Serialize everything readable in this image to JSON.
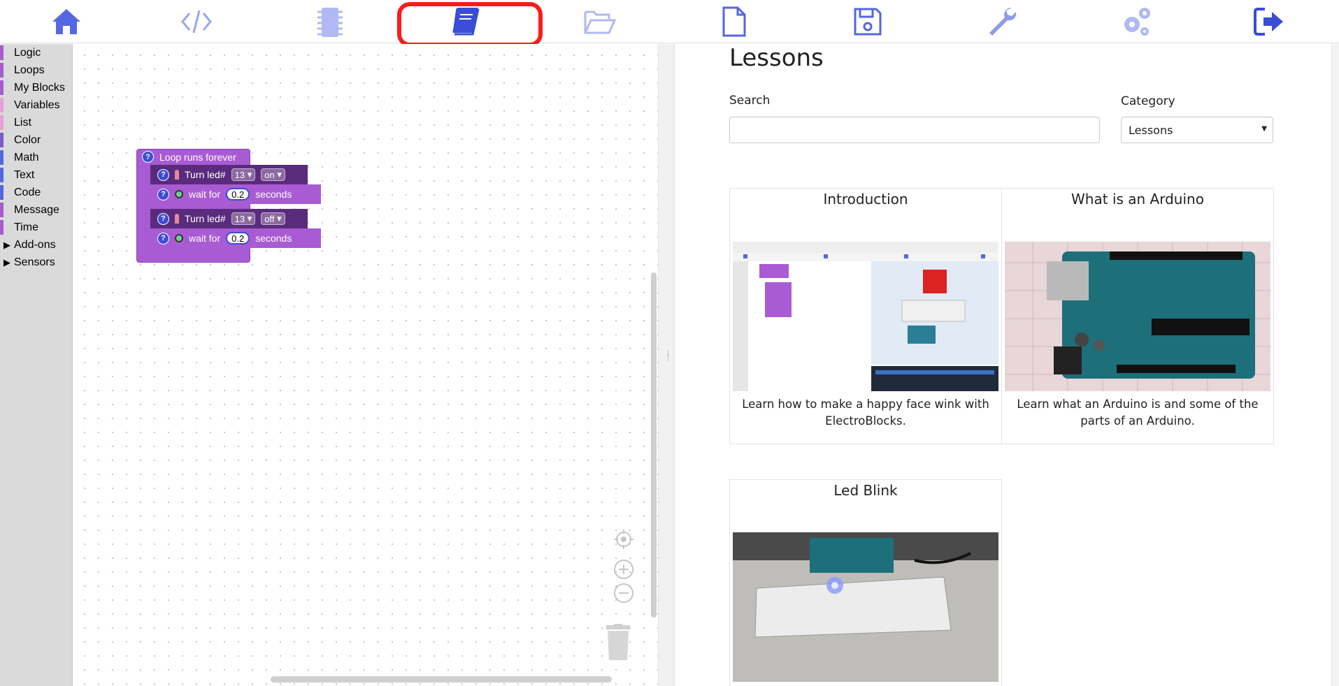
{
  "nav": {
    "items": [
      {
        "name": "home",
        "icon": "home-icon"
      },
      {
        "name": "code",
        "icon": "code-icon"
      },
      {
        "name": "chip",
        "icon": "chip-icon"
      },
      {
        "name": "lessons",
        "icon": "book-icon",
        "active": true
      },
      {
        "name": "open",
        "icon": "folder-open-icon"
      },
      {
        "name": "new",
        "icon": "new-file-icon"
      },
      {
        "name": "save",
        "icon": "save-icon"
      },
      {
        "name": "tools",
        "icon": "wrench-icon"
      },
      {
        "name": "settings",
        "icon": "gears-icon"
      },
      {
        "name": "exit",
        "icon": "sign-out-icon"
      }
    ],
    "icon_color": "#5567e0",
    "active_ring_color": "#ff1a1a"
  },
  "toolbox": {
    "categories": [
      {
        "label": "Logic",
        "color": "#a55ccf"
      },
      {
        "label": "Loops",
        "color": "#a55ccf"
      },
      {
        "label": "My Blocks",
        "color": "#a55ccf"
      },
      {
        "label": "Variables",
        "color": "#e8a0d8"
      },
      {
        "label": "List",
        "color": "#e8a0d8"
      },
      {
        "label": "Color",
        "color": "#7a5ccf"
      },
      {
        "label": "Math",
        "color": "#5567e0"
      },
      {
        "label": "Text",
        "color": "#5567e0"
      },
      {
        "label": "Code",
        "color": "#5567e0"
      },
      {
        "label": "Message",
        "color": "#a55ccf"
      },
      {
        "label": "Time",
        "color": "#a55ccf"
      },
      {
        "label": "Add-ons",
        "color": "#dadada",
        "expandable": true
      },
      {
        "label": "Sensors",
        "color": "#dadada",
        "expandable": true
      }
    ]
  },
  "blocks": {
    "loop_label": "Loop runs forever",
    "help": "?",
    "led_label": "Turn led#",
    "led_on_pin": "13",
    "led_on_state": "on",
    "wait_label": "wait for",
    "wait_value_1": "0.2",
    "seconds_label": "seconds",
    "led_off_pin": "13",
    "led_off_state": "off",
    "wait_value_2": "0.2"
  },
  "lessons": {
    "title": "Lessons",
    "search_label": "Search",
    "search_value": "",
    "category_label": "Category",
    "category_value": "Lessons",
    "cards": [
      {
        "title": "Introduction",
        "desc": "Learn how to make a happy face wink with ElectroBlocks."
      },
      {
        "title": "What is an Arduino",
        "desc": "Learn what an Arduino is and some of the parts of an Arduino."
      },
      {
        "title": "Led Blink",
        "desc": ""
      }
    ]
  }
}
